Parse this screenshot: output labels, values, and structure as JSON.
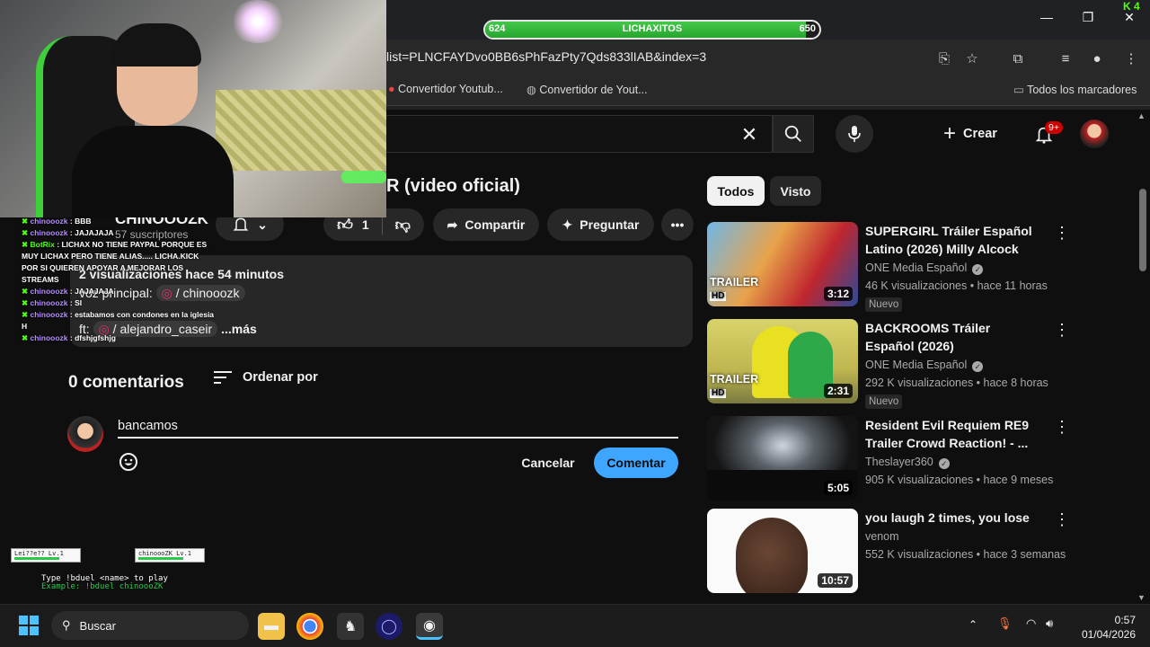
{
  "browser": {
    "url": "list=PLNCFAYDvo0BB6sPhFazPty7Qds833lIAB&index=3",
    "bookmarks": [
      "Convertidor Youtub...",
      "Convertidor de Yout...",
      "Todos los marcadores"
    ]
  },
  "stream_goal": {
    "label": "LICHAXITOS",
    "current": "624",
    "target": "650",
    "progress_fraction": 0.96
  },
  "yt_header": {
    "create_label": "Crear",
    "notifications_badge": "9+"
  },
  "video": {
    "title_fragment": "R (video oficial)",
    "channel_name": "CHINOOOZK",
    "subscribers": "57 suscriptores",
    "like_count": "1",
    "share_label": "Compartir",
    "ask_label": "Preguntar",
    "views_line": "2 visualizaciones  hace 54 minutos",
    "desc_line2_prefix": "voz principal:",
    "desc_line2_handle": "/ chinooozk",
    "desc_line3_prefix": "ft:",
    "desc_line3_handle": "/ alejandro_caseir",
    "more_label": "...más"
  },
  "comments": {
    "count_label": "0 comentarios",
    "sort_label": "Ordenar por",
    "input_value": "bancamos",
    "cancel_label": "Cancelar",
    "submit_label": "Comentar"
  },
  "sidebar": {
    "chips": [
      "Todos",
      "Visto"
    ],
    "videos": [
      {
        "title": "SUPERGIRL Tráiler Español Latino (2026) Milly Alcock",
        "channel": "ONE Media Español",
        "meta": "46 K visualizaciones • hace 11 horas",
        "badge": "Nuevo",
        "duration": "3:12",
        "overlay": "TRAILER",
        "hd": "HD"
      },
      {
        "title": "BACKROOMS Tráiler Español (2026)",
        "channel": "ONE Media Español",
        "meta": "292 K visualizaciones • hace 8 horas",
        "badge": "Nuevo",
        "duration": "2:31",
        "overlay": "TRAILER",
        "hd": "HD"
      },
      {
        "title": "Resident Evil Requiem RE9 Trailer Crowd Reaction! - ...",
        "channel": "Theslayer360",
        "meta": "905 K visualizaciones • hace 9 meses",
        "badge": "",
        "duration": "5:05"
      },
      {
        "title": "you laugh 2 times, you lose",
        "channel": "venom",
        "meta": "552 K visualizaciones • hace 3 semanas",
        "badge": "",
        "duration": "10:57"
      }
    ]
  },
  "chat": {
    "messages": [
      {
        "user": "chinooozk",
        "text": "BBB"
      },
      {
        "user": "chinooozk",
        "text": "JAJAJAJA"
      },
      {
        "user": "BotRix",
        "text": "LICHAX NO TIENE PAYPAL PORQUE ES MUY LICHAX PERO TIENE ALIAS..... LICHA.KICK POR SI QUIEREN APOYAR A MEJORAR LOS STREAMS"
      },
      {
        "user": "chinooozk",
        "text": "JAJAJAJA"
      },
      {
        "user": "chinooozk",
        "text": "SI"
      },
      {
        "user": "chinooozk",
        "text": "estabamos con condones en la iglesia H"
      },
      {
        "user": "chinooozk",
        "text": "dfshjgfshjg"
      }
    ]
  },
  "duel": {
    "player1": "Lei??e?? Lv.1",
    "player2": "chinoooZK Lv.1",
    "line1": "Type !bduel <name> to play",
    "line2": "Example: !bduel chinoooZK"
  },
  "taskbar": {
    "search_placeholder": "Buscar",
    "time": "0:57",
    "date": "01/04/2026"
  },
  "colors": {
    "accent_blue": "#3ea6ff",
    "goal_green": "#27a52d",
    "notif_red": "#cc0000",
    "chat_name_purple": "#b48cff"
  }
}
